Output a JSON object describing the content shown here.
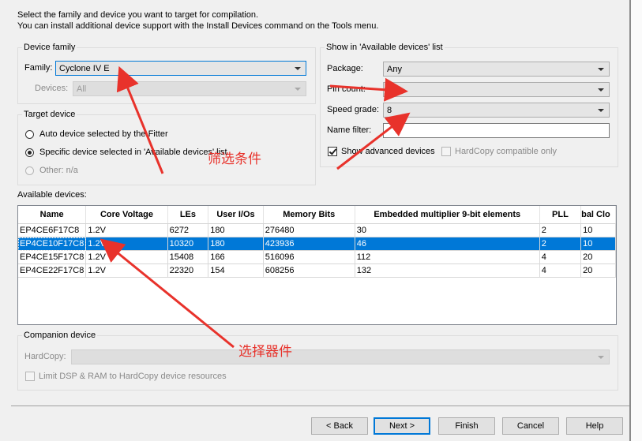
{
  "intro": {
    "line1": "Select the family and device you want to target for compilation.",
    "line2": "You can install additional device support with the Install Devices command on the Tools menu."
  },
  "device_family": {
    "title": "Device family",
    "family_label": "Family:",
    "family_value": "Cyclone IV E",
    "devices_label": "Devices:",
    "devices_value": "All"
  },
  "target_device": {
    "title": "Target device",
    "option_auto": "Auto device selected by the Fitter",
    "option_specific": "Specific device selected in 'Available devices' list",
    "option_other": "Other:  n/a"
  },
  "show_list": {
    "title": "Show in 'Available devices' list",
    "package_label": "Package:",
    "package_value": "Any",
    "pin_count_label": "Pin count:",
    "pin_count_value": "256",
    "speed_grade_label": "Speed grade:",
    "speed_grade_value": "8",
    "name_filter_label": "Name filter:",
    "name_filter_value": "",
    "show_advanced": "Show advanced devices",
    "hardcopy_compat": "HardCopy compatible only"
  },
  "available": {
    "label": "Available devices:",
    "columns": [
      "Name",
      "Core Voltage",
      "LEs",
      "User I/Os",
      "Memory Bits",
      "Embedded multiplier 9-bit elements",
      "PLL",
      "bal Clo"
    ],
    "rows": [
      [
        "EP4CE6F17C8",
        "1.2V",
        "6272",
        "180",
        "276480",
        "30",
        "2",
        "10"
      ],
      [
        "EP4CE10F17C8",
        "1.2V",
        "10320",
        "180",
        "423936",
        "46",
        "2",
        "10"
      ],
      [
        "EP4CE15F17C8",
        "1.2V",
        "15408",
        "166",
        "516096",
        "112",
        "4",
        "20"
      ],
      [
        "EP4CE22F17C8",
        "1.2V",
        "22320",
        "154",
        "608256",
        "132",
        "4",
        "20"
      ]
    ],
    "selected_row": 1
  },
  "companion": {
    "title": "Companion device",
    "hardcopy_label": "HardCopy:",
    "hardcopy_value": "",
    "limit_label": "Limit DSP & RAM to HardCopy device resources"
  },
  "buttons": {
    "back": "< Back",
    "next": "Next >",
    "finish": "Finish",
    "cancel": "Cancel",
    "help": "Help"
  },
  "annotations": {
    "filter": "筛选条件",
    "select": "选择器件"
  },
  "colors": {
    "annotation": "#e8322b",
    "selection": "#0078d7"
  }
}
